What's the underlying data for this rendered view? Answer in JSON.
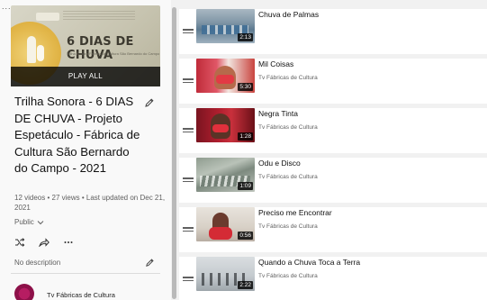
{
  "top_dots": "......",
  "playlist": {
    "thumbnail": {
      "title": "6 DIAS DE CHUVA",
      "subtitle": "Trilha Sonora Fábrica de Cultura São Bernardo do Campo"
    },
    "play_all_label": "PLAY ALL",
    "title": "Trilha Sonora - 6 DIAS DE CHUVA - Projeto Espetáculo - Fábrica de Cultura São Bernardo do Campo - 2021",
    "meta": "12 videos • 27 views • Last updated on Dec 21, 2021",
    "privacy": "Public",
    "description": "No description",
    "owner": "Tv Fábricas de Cultura"
  },
  "videos": [
    {
      "title": "Chuva de Palmas",
      "channel": "",
      "duration": "2:13"
    },
    {
      "title": "Mil Coisas",
      "channel": "Tv Fábricas de Cultura",
      "duration": "5:30"
    },
    {
      "title": "Negra Tinta",
      "channel": "Tv Fábricas de Cultura",
      "duration": "1:28"
    },
    {
      "title": "Odu e Disco",
      "channel": "Tv Fábricas de Cultura",
      "duration": "1:09"
    },
    {
      "title": "Preciso me Encontrar",
      "channel": "Tv Fábricas de Cultura",
      "duration": "0:56"
    },
    {
      "title": "Quando a Chuva Toca a Terra",
      "channel": "Tv Fábricas de Cultura",
      "duration": "2:22"
    }
  ],
  "icons": {
    "edit": "pencil-icon",
    "shuffle": "shuffle-icon",
    "share": "share-icon",
    "more": "more-horizontal-icon",
    "drag": "drag-handle-icon",
    "privacy_dropdown": "chevron-down-icon"
  }
}
